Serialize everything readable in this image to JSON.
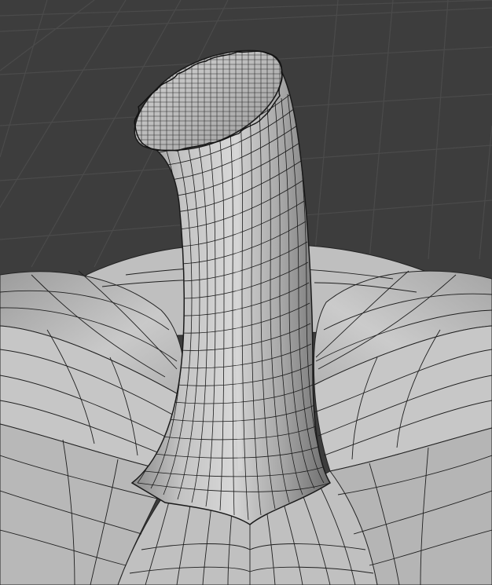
{
  "scene": {
    "subject": "pumpkin-stem",
    "shading": "solid",
    "overlay": "wireframe",
    "colors": {
      "background": "#3d3d3d",
      "grid": "#4a4a4a",
      "surface_light": "#cdcdcd",
      "surface_mid": "#a9a9a9",
      "surface_dark": "#6e6e6e",
      "wire": "#1a1a1a"
    }
  }
}
